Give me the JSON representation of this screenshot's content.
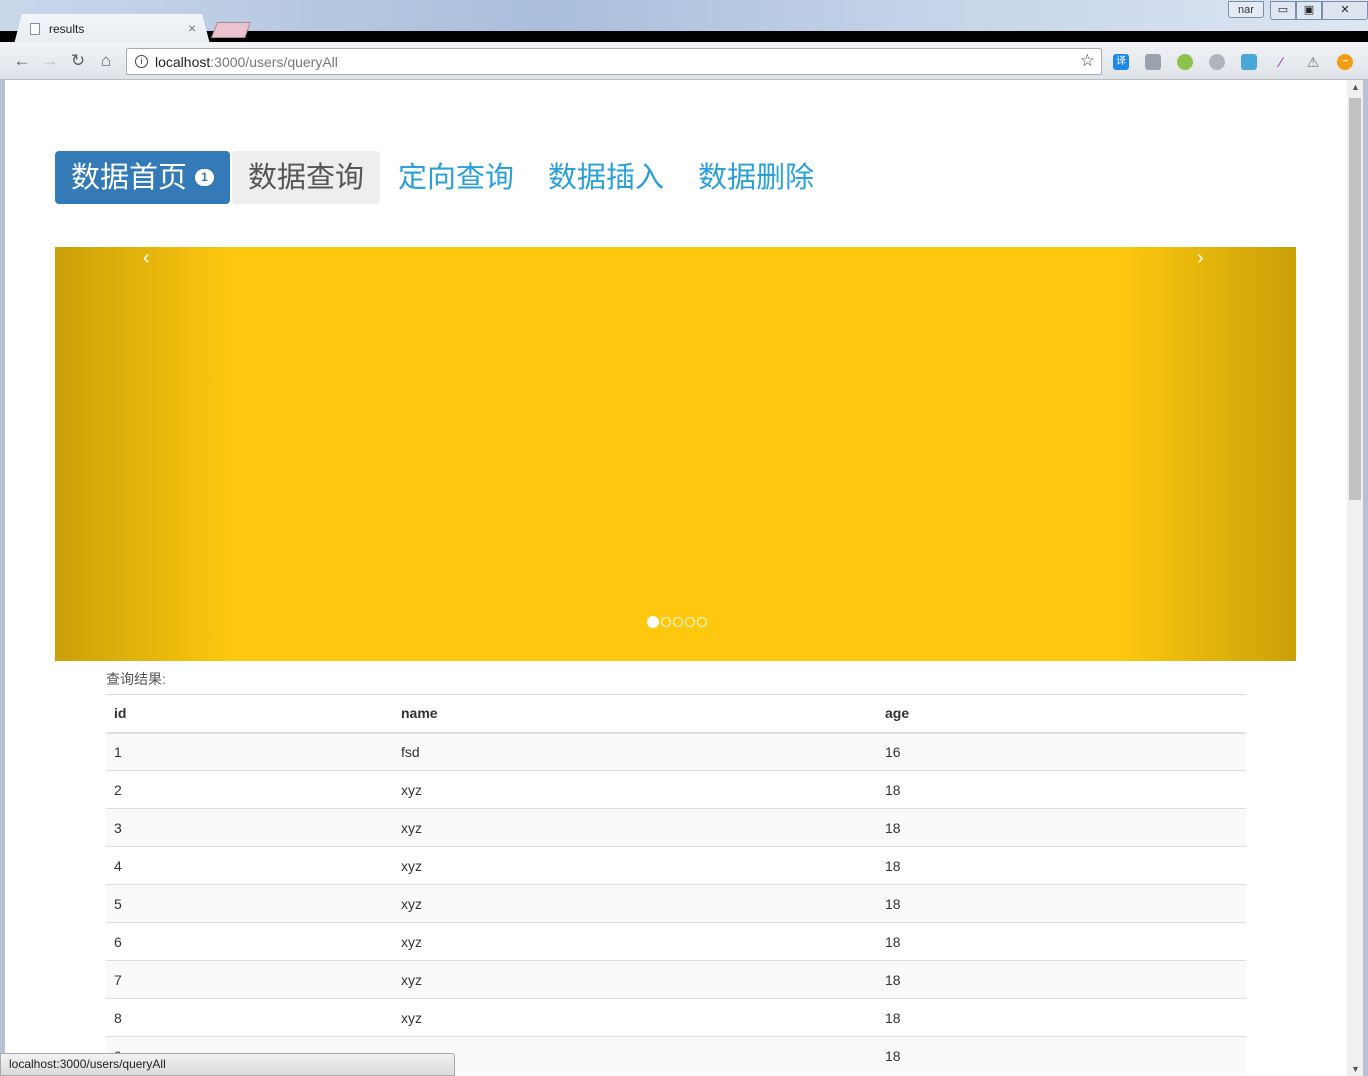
{
  "browser": {
    "tab_title": "results",
    "tab_close": "×",
    "user_badge": "nar",
    "controls": {
      "minimize": "▭",
      "maximize": "▣",
      "close": "✕"
    },
    "url_host": "localhost",
    "url_path": ":3000/users/queryAll",
    "info_icon": "i",
    "bookmark_icon": "☆",
    "nav": {
      "back": "←",
      "forward": "→",
      "reload": "↻",
      "home": "⌂"
    },
    "extensions": [
      "translate-icon",
      "plugin-icon",
      "frog-icon",
      "circle-icon",
      "screenshot-icon",
      "pen-icon",
      "warning-icon",
      "minus-circle-icon"
    ]
  },
  "nav": {
    "items": [
      {
        "label": "数据首页",
        "badge": "1",
        "state": "active"
      },
      {
        "label": "数据查询",
        "state": "hover"
      },
      {
        "label": "定向查询",
        "state": "link"
      },
      {
        "label": "数据插入",
        "state": "link"
      },
      {
        "label": "数据删除",
        "state": "link"
      }
    ]
  },
  "carousel": {
    "prev": "‹",
    "next": "›",
    "background": "#fec80f",
    "slide_count": 5,
    "active_slide": 1
  },
  "results": {
    "label": "查询结果:",
    "columns": [
      "id",
      "name",
      "age"
    ],
    "rows": [
      [
        "1",
        "fsd",
        "16"
      ],
      [
        "2",
        "xyz",
        "18"
      ],
      [
        "3",
        "xyz",
        "18"
      ],
      [
        "4",
        "xyz",
        "18"
      ],
      [
        "5",
        "xyz",
        "18"
      ],
      [
        "6",
        "xyz",
        "18"
      ],
      [
        "7",
        "xyz",
        "18"
      ],
      [
        "8",
        "xyz",
        "18"
      ],
      [
        "9",
        "",
        "18"
      ]
    ]
  },
  "status": {
    "text": "localhost:3000/users/queryAll"
  },
  "colors": {
    "primary": "#337ab7",
    "link": "#2aa0d8"
  }
}
